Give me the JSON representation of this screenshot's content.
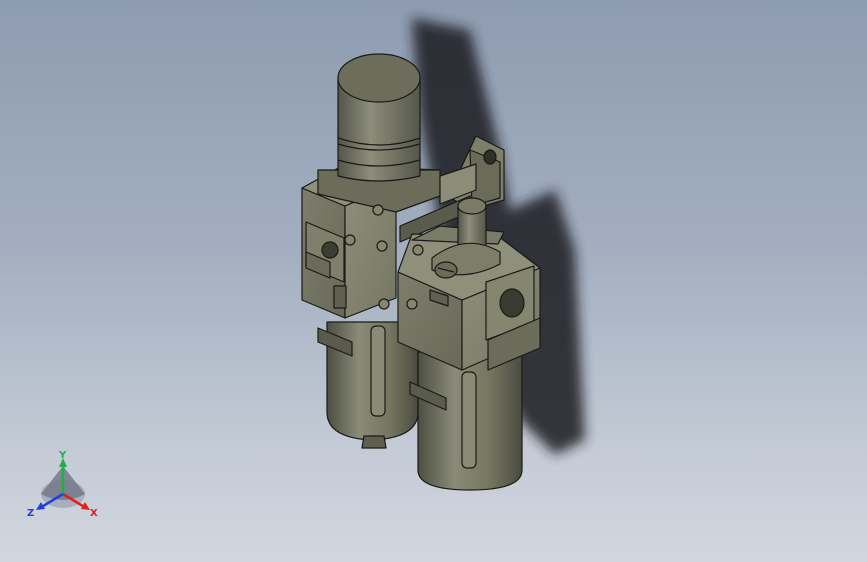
{
  "viewport": {
    "background_top": "#8e9cb1",
    "background_bottom": "#d2d6de"
  },
  "model": {
    "body_color": "#6f705e",
    "edge_color": "#1a1a16"
  },
  "triad": {
    "x_label": "X",
    "y_label": "Y",
    "z_label": "Z",
    "x_color": "#e02020",
    "y_color": "#20b040",
    "z_color": "#2040e0"
  }
}
